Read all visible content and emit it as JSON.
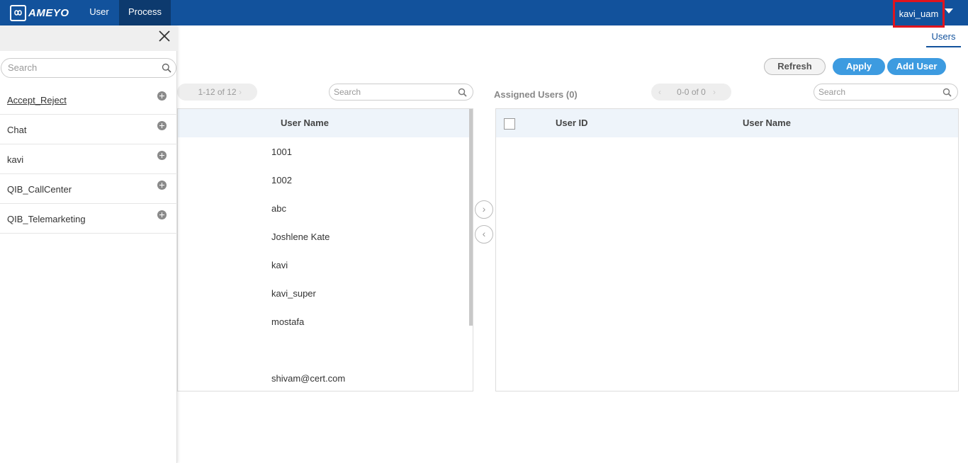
{
  "header": {
    "logo_text": "AMEYO",
    "nav": [
      "User",
      "Process"
    ],
    "active_nav": "Process",
    "username": "kavi_uam"
  },
  "subtabs": {
    "users": "Users"
  },
  "toolbar": {
    "refresh": "Refresh",
    "apply": "Apply",
    "add_user": "Add User"
  },
  "available": {
    "pager": "1-12 of 12",
    "search_placeholder": "Search",
    "col_user_name": "User Name",
    "rows": [
      "1001",
      "1002",
      "abc",
      "Joshlene Kate",
      "kavi",
      "kavi_super",
      "mostafa",
      "",
      "shivam@cert.com"
    ]
  },
  "assigned": {
    "title": "Assigned Users (0)",
    "pager": "0-0 of 0",
    "search_placeholder": "Search",
    "col_user_id": "User ID",
    "col_user_name": "User Name"
  },
  "drawer": {
    "search_placeholder": "Search",
    "items": [
      "Accept_Reject",
      "Chat",
      "kavi",
      "QIB_CallCenter",
      "QIB_Telemarketing"
    ]
  },
  "colors": {
    "header": "#12529c",
    "accent": "#3d9be0",
    "highlight": "#e0141e"
  }
}
